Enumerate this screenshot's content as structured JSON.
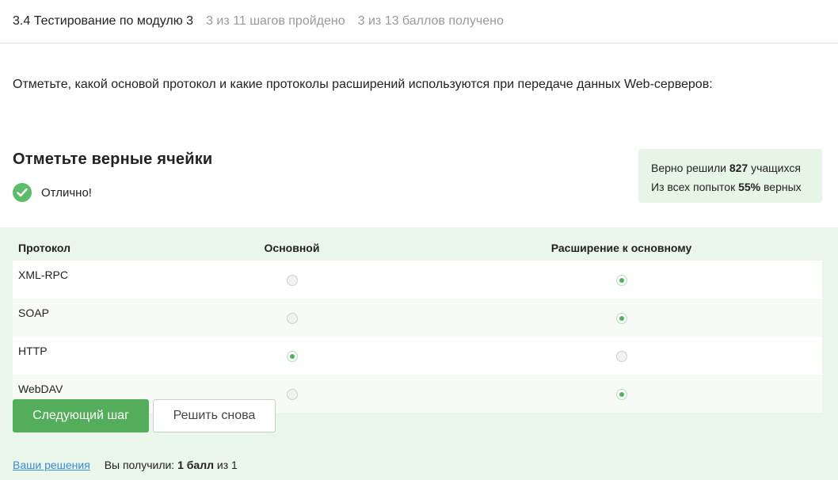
{
  "header": {
    "title": "3.4 Тестирование по модулю 3",
    "steps": "3 из 11 шагов пройдено",
    "points": "3 из 13 баллов  получено"
  },
  "question": "Отметьте, какой основой протокол и какие протоколы расширений используются при передаче данных Web-серверов:",
  "task": {
    "title": "Отметьте верные ячейки",
    "status": "Отлично!"
  },
  "stats": {
    "line1_prefix": "Верно решили",
    "solved_count": "827",
    "line1_suffix": "учащихся",
    "line2_prefix": "Из всех попыток",
    "percent": "55%",
    "line2_suffix": "верных"
  },
  "table": {
    "headers": [
      "Протокол",
      "Основной",
      "Расширение к основному"
    ],
    "rows": [
      {
        "name": "XML-RPC",
        "main": false,
        "extension": true
      },
      {
        "name": "SOAP",
        "main": false,
        "extension": true
      },
      {
        "name": "HTTP",
        "main": true,
        "extension": false
      },
      {
        "name": "WebDAV",
        "main": false,
        "extension": true
      }
    ]
  },
  "buttons": {
    "next": "Следующий шаг",
    "retry": "Решить снова"
  },
  "footer": {
    "solutions_link": "Ваши решения",
    "received_prefix": "Вы получили:",
    "score": "1 балл",
    "received_suffix": "из 1"
  },
  "colors": {
    "accent": "#54ad5b",
    "success_bg": "#e9f6e9",
    "link": "#3a8ad6"
  },
  "icons": {
    "status": "check-circle-icon"
  }
}
